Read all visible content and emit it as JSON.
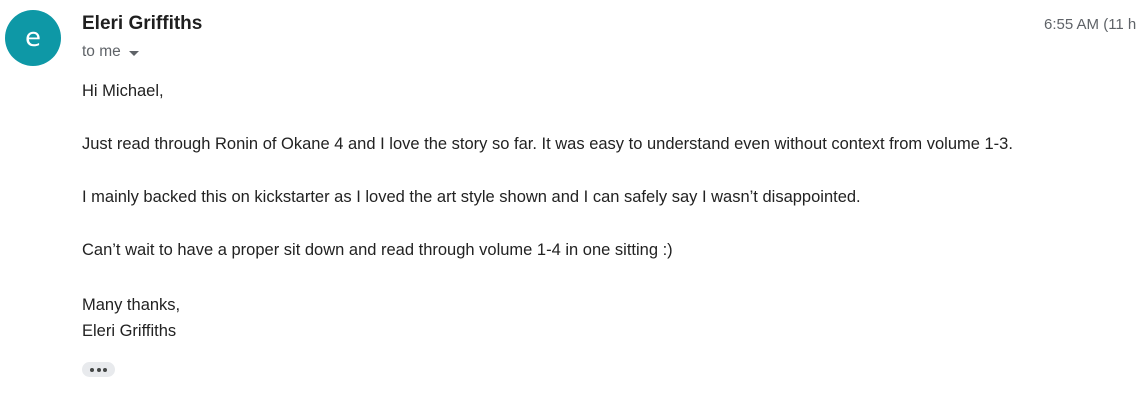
{
  "sender": {
    "avatar_letter": "e",
    "avatar_color": "#0e98a6",
    "name": "Eleri Griffiths"
  },
  "timestamp": "6:55 AM (11 h",
  "recipient": {
    "label": "to me",
    "details_icon": "caret-down-icon"
  },
  "body": {
    "greeting": "Hi Michael,",
    "paragraph_1": "Just read through Ronin of Okane 4 and I love the story so far. It was easy to understand even without context from volume 1-3.",
    "paragraph_2": "I mainly backed this on kickstarter as I loved the art style shown and I can safely say I wasn’t disappointed.",
    "paragraph_3": "Can’t wait to have a proper sit down and read through volume 1-4 in one sitting :)",
    "signoff": "Many thanks,",
    "signature": "Eleri Griffiths"
  },
  "show_trimmed_content_icon": "more-horizontal-icon"
}
